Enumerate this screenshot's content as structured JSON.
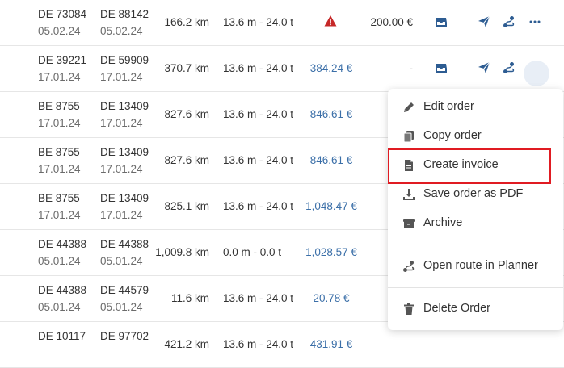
{
  "rows": [
    {
      "from_plate": "DE 73084",
      "from_date": "05.02.24",
      "to_plate": "DE 88142",
      "to_date": "05.02.24",
      "distance": "166.2 km",
      "dimensions": "13.6 m - 24.0 t",
      "price": "",
      "warning": true,
      "amount": "200.00 €"
    },
    {
      "from_plate": "DE 39221",
      "from_date": "17.01.24",
      "to_plate": "DE 59909",
      "to_date": "17.01.24",
      "distance": "370.7 km",
      "dimensions": "13.6 m - 24.0 t",
      "price": "384.24 €",
      "warning": false,
      "amount": "-"
    },
    {
      "from_plate": "BE 8755",
      "from_date": "17.01.24",
      "to_plate": "DE 13409",
      "to_date": "17.01.24",
      "distance": "827.6 km",
      "dimensions": "13.6 m - 24.0 t",
      "price": "846.61 €",
      "warning": false,
      "amount": ""
    },
    {
      "from_plate": "BE 8755",
      "from_date": "17.01.24",
      "to_plate": "DE 13409",
      "to_date": "17.01.24",
      "distance": "827.6 km",
      "dimensions": "13.6 m - 24.0 t",
      "price": "846.61 €",
      "warning": false,
      "amount": ""
    },
    {
      "from_plate": "BE 8755",
      "from_date": "17.01.24",
      "to_plate": "DE 13409",
      "to_date": "17.01.24",
      "distance": "825.1 km",
      "dimensions": "13.6 m - 24.0 t",
      "price": "1,048.47 €",
      "warning": false,
      "amount": ""
    },
    {
      "from_plate": "DE 44388",
      "from_date": "05.01.24",
      "to_plate": "DE 44388",
      "to_date": "05.01.24",
      "distance": "1,009.8 km",
      "dimensions": "0.0 m - 0.0 t",
      "price": "1,028.57 €",
      "warning": false,
      "amount": ""
    },
    {
      "from_plate": "DE 44388",
      "from_date": "05.01.24",
      "to_plate": "DE 44579",
      "to_date": "05.01.24",
      "distance": "11.6 km",
      "dimensions": "13.6 m - 24.0 t",
      "price": "20.78 €",
      "warning": false,
      "amount": ""
    },
    {
      "from_plate": "DE 10117",
      "from_date": "",
      "to_plate": "DE 97702",
      "to_date": "",
      "distance": "421.2 km",
      "dimensions": "13.6 m - 24.0 t",
      "price": "431.91 €",
      "warning": false,
      "amount": ""
    }
  ],
  "menu": {
    "items": [
      {
        "label": "Edit order",
        "icon": "pencil-icon"
      },
      {
        "label": "Copy order",
        "icon": "copy-icon"
      },
      {
        "label": "Create invoice",
        "icon": "document-icon"
      },
      {
        "label": "Save order as PDF",
        "icon": "download-icon"
      },
      {
        "label": "Archive",
        "icon": "archive-icon"
      },
      {
        "label": "Open route in Planner",
        "icon": "route-icon"
      },
      {
        "label": "Delete Order",
        "icon": "trash-icon"
      }
    ]
  },
  "colors": {
    "link_blue": "#3b6fa8",
    "icon_blue": "#2d5c92",
    "warning_red": "#c62828",
    "highlight_red": "#e01b22"
  }
}
